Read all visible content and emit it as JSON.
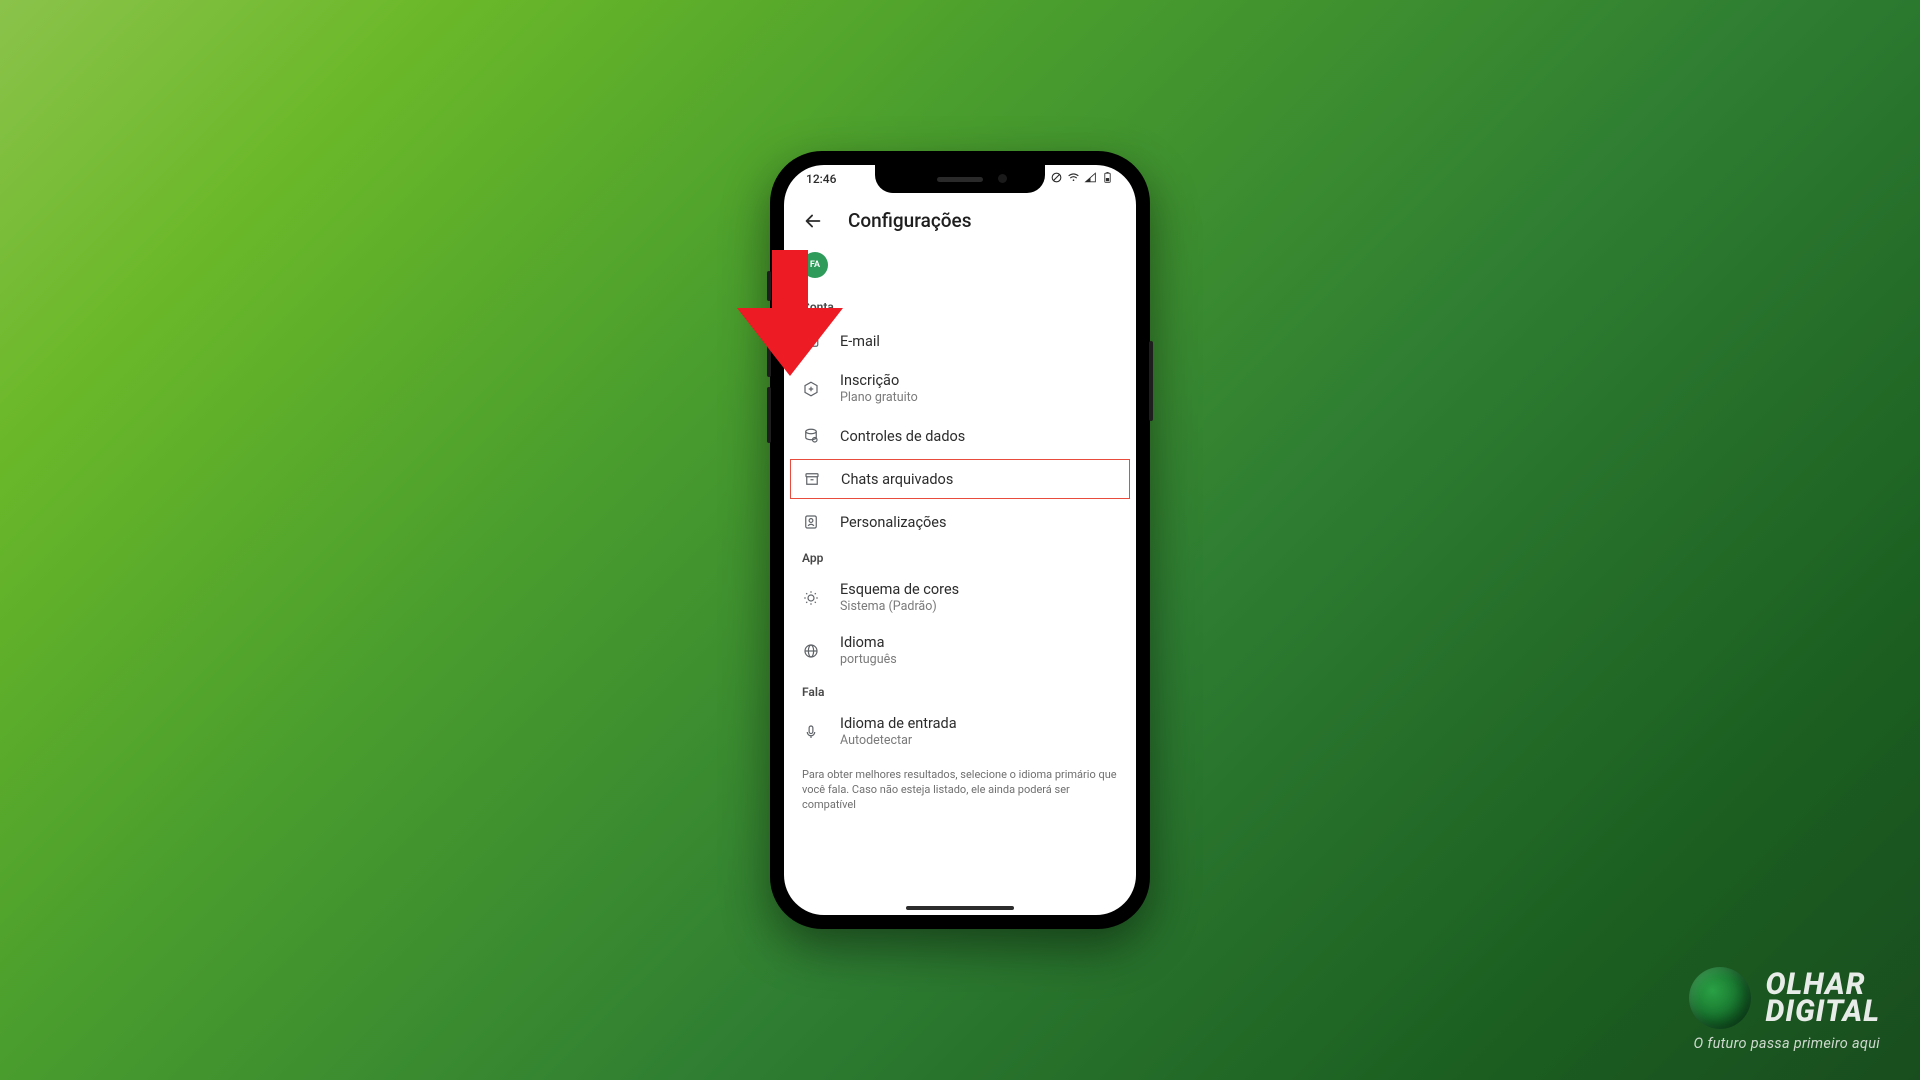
{
  "status": {
    "time": "12:46"
  },
  "header": {
    "title": "Configurações"
  },
  "avatar": {
    "initials": "FA"
  },
  "sections": {
    "conta": {
      "label": "Conta",
      "items": {
        "email": {
          "title": "E-mail"
        },
        "inscricao": {
          "title": "Inscrição",
          "sub": "Plano gratuito"
        },
        "controles": {
          "title": "Controles de dados"
        },
        "arquivados": {
          "title": "Chats arquivados"
        },
        "personalizacoes": {
          "title": "Personalizações"
        }
      }
    },
    "app": {
      "label": "App",
      "items": {
        "cores": {
          "title": "Esquema de cores",
          "sub": "Sistema (Padrão)"
        },
        "idioma": {
          "title": "Idioma",
          "sub": "português"
        }
      }
    },
    "fala": {
      "label": "Fala",
      "items": {
        "entrada": {
          "title": "Idioma de entrada",
          "sub": "Autodetectar"
        }
      }
    }
  },
  "footnote": "Para obter melhores resultados, selecione o idioma primário que você fala. Caso não esteja listado, ele ainda poderá ser compatível",
  "brand": {
    "line1": "OLHAR",
    "line2": "DIGITAL",
    "tagline": "O futuro passa primeiro aqui"
  }
}
